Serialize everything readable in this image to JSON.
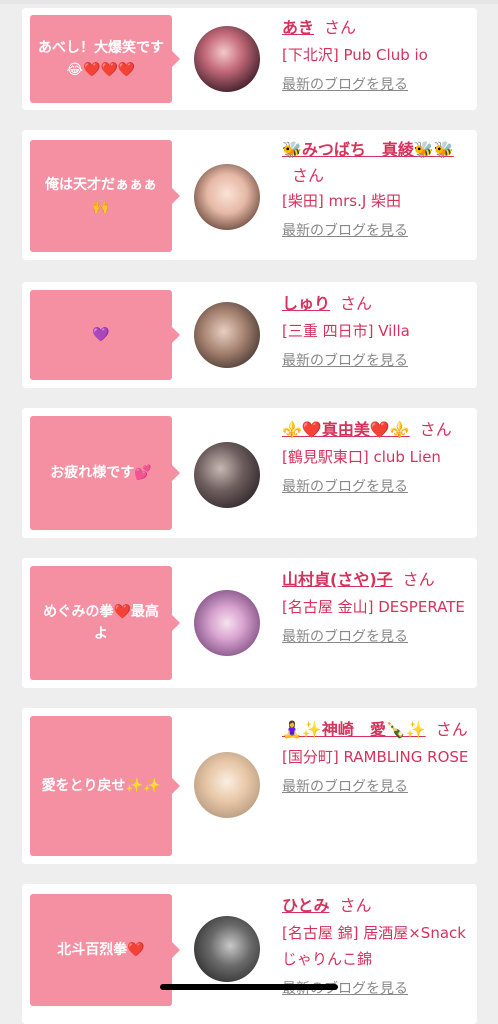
{
  "users": [
    {
      "message": "あべし！大爆笑です😂❤️❤️❤️",
      "name": "あき",
      "honorific": "さん",
      "shop": "[下北沢] Pub Club io",
      "blog_link": "最新のブログを見る"
    },
    {
      "message": "俺は天才だぁぁぁ🙌",
      "name": "🐝みつばち　真綾🐝🐝",
      "honorific": "さん",
      "shop": "[柴田] mrs.J 柴田",
      "blog_link": "最新のブログを見る"
    },
    {
      "message": "💜",
      "name": "しゅり",
      "honorific": "さん",
      "shop": "[三重 四日市] Villa",
      "blog_link": "最新のブログを見る"
    },
    {
      "message": "お疲れ様です💕",
      "name": "⚜️❤️真由美❤️⚜️",
      "honorific": "さん",
      "shop": "[鶴見駅東口] club Lien",
      "blog_link": "最新のブログを見る"
    },
    {
      "message": "めぐみの拳❤️最高よ",
      "name": "山村貞(さや)子",
      "honorific": "さん",
      "shop": "[名古屋 金山] DESPERATE",
      "blog_link": "最新のブログを見る"
    },
    {
      "message": "愛をとり戻せ✨✨",
      "name": "🧘‍♀️✨神崎　愛🍾✨",
      "honorific": "さん",
      "shop": "[国分町] RAMBLING ROSE",
      "blog_link": "最新のブログを見る"
    },
    {
      "message": "北斗百烈拳❤️",
      "name": "ひとみ",
      "honorific": "さん",
      "shop": "[名古屋 錦] 居酒屋×Snack じゃりんこ錦",
      "blog_link": "最新のブログを見る"
    }
  ]
}
